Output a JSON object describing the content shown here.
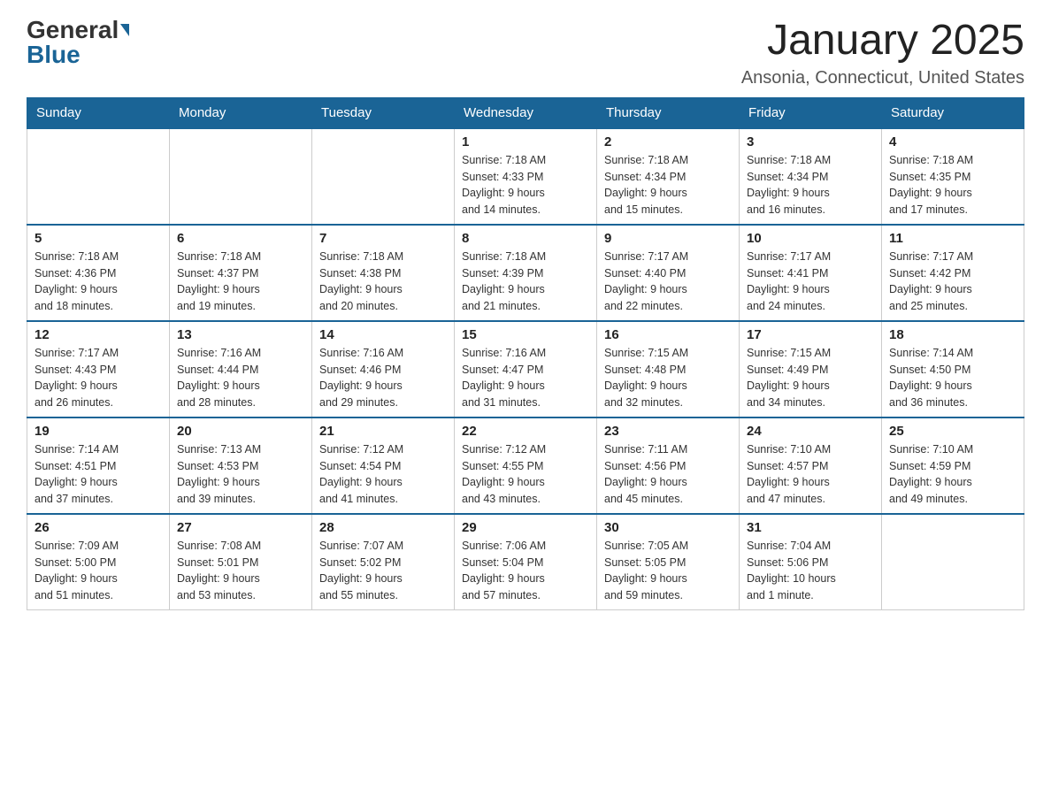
{
  "logo": {
    "general": "General",
    "blue": "Blue"
  },
  "title": "January 2025",
  "location": "Ansonia, Connecticut, United States",
  "weekdays": [
    "Sunday",
    "Monday",
    "Tuesday",
    "Wednesday",
    "Thursday",
    "Friday",
    "Saturday"
  ],
  "weeks": [
    [
      {
        "day": "",
        "info": ""
      },
      {
        "day": "",
        "info": ""
      },
      {
        "day": "",
        "info": ""
      },
      {
        "day": "1",
        "info": "Sunrise: 7:18 AM\nSunset: 4:33 PM\nDaylight: 9 hours\nand 14 minutes."
      },
      {
        "day": "2",
        "info": "Sunrise: 7:18 AM\nSunset: 4:34 PM\nDaylight: 9 hours\nand 15 minutes."
      },
      {
        "day": "3",
        "info": "Sunrise: 7:18 AM\nSunset: 4:34 PM\nDaylight: 9 hours\nand 16 minutes."
      },
      {
        "day": "4",
        "info": "Sunrise: 7:18 AM\nSunset: 4:35 PM\nDaylight: 9 hours\nand 17 minutes."
      }
    ],
    [
      {
        "day": "5",
        "info": "Sunrise: 7:18 AM\nSunset: 4:36 PM\nDaylight: 9 hours\nand 18 minutes."
      },
      {
        "day": "6",
        "info": "Sunrise: 7:18 AM\nSunset: 4:37 PM\nDaylight: 9 hours\nand 19 minutes."
      },
      {
        "day": "7",
        "info": "Sunrise: 7:18 AM\nSunset: 4:38 PM\nDaylight: 9 hours\nand 20 minutes."
      },
      {
        "day": "8",
        "info": "Sunrise: 7:18 AM\nSunset: 4:39 PM\nDaylight: 9 hours\nand 21 minutes."
      },
      {
        "day": "9",
        "info": "Sunrise: 7:17 AM\nSunset: 4:40 PM\nDaylight: 9 hours\nand 22 minutes."
      },
      {
        "day": "10",
        "info": "Sunrise: 7:17 AM\nSunset: 4:41 PM\nDaylight: 9 hours\nand 24 minutes."
      },
      {
        "day": "11",
        "info": "Sunrise: 7:17 AM\nSunset: 4:42 PM\nDaylight: 9 hours\nand 25 minutes."
      }
    ],
    [
      {
        "day": "12",
        "info": "Sunrise: 7:17 AM\nSunset: 4:43 PM\nDaylight: 9 hours\nand 26 minutes."
      },
      {
        "day": "13",
        "info": "Sunrise: 7:16 AM\nSunset: 4:44 PM\nDaylight: 9 hours\nand 28 minutes."
      },
      {
        "day": "14",
        "info": "Sunrise: 7:16 AM\nSunset: 4:46 PM\nDaylight: 9 hours\nand 29 minutes."
      },
      {
        "day": "15",
        "info": "Sunrise: 7:16 AM\nSunset: 4:47 PM\nDaylight: 9 hours\nand 31 minutes."
      },
      {
        "day": "16",
        "info": "Sunrise: 7:15 AM\nSunset: 4:48 PM\nDaylight: 9 hours\nand 32 minutes."
      },
      {
        "day": "17",
        "info": "Sunrise: 7:15 AM\nSunset: 4:49 PM\nDaylight: 9 hours\nand 34 minutes."
      },
      {
        "day": "18",
        "info": "Sunrise: 7:14 AM\nSunset: 4:50 PM\nDaylight: 9 hours\nand 36 minutes."
      }
    ],
    [
      {
        "day": "19",
        "info": "Sunrise: 7:14 AM\nSunset: 4:51 PM\nDaylight: 9 hours\nand 37 minutes."
      },
      {
        "day": "20",
        "info": "Sunrise: 7:13 AM\nSunset: 4:53 PM\nDaylight: 9 hours\nand 39 minutes."
      },
      {
        "day": "21",
        "info": "Sunrise: 7:12 AM\nSunset: 4:54 PM\nDaylight: 9 hours\nand 41 minutes."
      },
      {
        "day": "22",
        "info": "Sunrise: 7:12 AM\nSunset: 4:55 PM\nDaylight: 9 hours\nand 43 minutes."
      },
      {
        "day": "23",
        "info": "Sunrise: 7:11 AM\nSunset: 4:56 PM\nDaylight: 9 hours\nand 45 minutes."
      },
      {
        "day": "24",
        "info": "Sunrise: 7:10 AM\nSunset: 4:57 PM\nDaylight: 9 hours\nand 47 minutes."
      },
      {
        "day": "25",
        "info": "Sunrise: 7:10 AM\nSunset: 4:59 PM\nDaylight: 9 hours\nand 49 minutes."
      }
    ],
    [
      {
        "day": "26",
        "info": "Sunrise: 7:09 AM\nSunset: 5:00 PM\nDaylight: 9 hours\nand 51 minutes."
      },
      {
        "day": "27",
        "info": "Sunrise: 7:08 AM\nSunset: 5:01 PM\nDaylight: 9 hours\nand 53 minutes."
      },
      {
        "day": "28",
        "info": "Sunrise: 7:07 AM\nSunset: 5:02 PM\nDaylight: 9 hours\nand 55 minutes."
      },
      {
        "day": "29",
        "info": "Sunrise: 7:06 AM\nSunset: 5:04 PM\nDaylight: 9 hours\nand 57 minutes."
      },
      {
        "day": "30",
        "info": "Sunrise: 7:05 AM\nSunset: 5:05 PM\nDaylight: 9 hours\nand 59 minutes."
      },
      {
        "day": "31",
        "info": "Sunrise: 7:04 AM\nSunset: 5:06 PM\nDaylight: 10 hours\nand 1 minute."
      },
      {
        "day": "",
        "info": ""
      }
    ]
  ]
}
